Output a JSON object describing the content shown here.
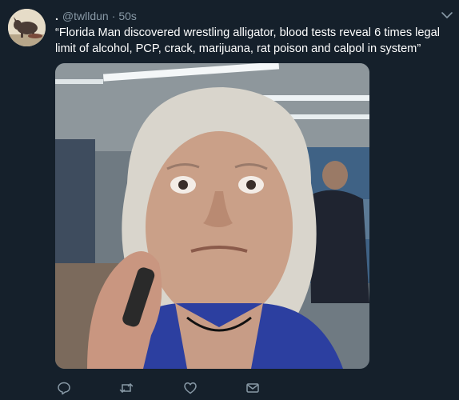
{
  "tweet": {
    "display_name": ".",
    "handle": "@twlldun",
    "separator": "·",
    "timestamp": "50s",
    "text": "“Florida Man discovered wrestling alligator, blood tests reveal 6 times legal limit of alcohol, PCP, crack, marijuana, rat poison and calpol in system”"
  },
  "icons": {
    "menu": "chevron-down-icon",
    "reply": "reply-icon",
    "retweet": "retweet-icon",
    "like": "heart-icon",
    "share": "envelope-icon"
  },
  "colors": {
    "background": "#15202b",
    "secondary_text": "#8899a6",
    "icon": "#8899a6"
  }
}
